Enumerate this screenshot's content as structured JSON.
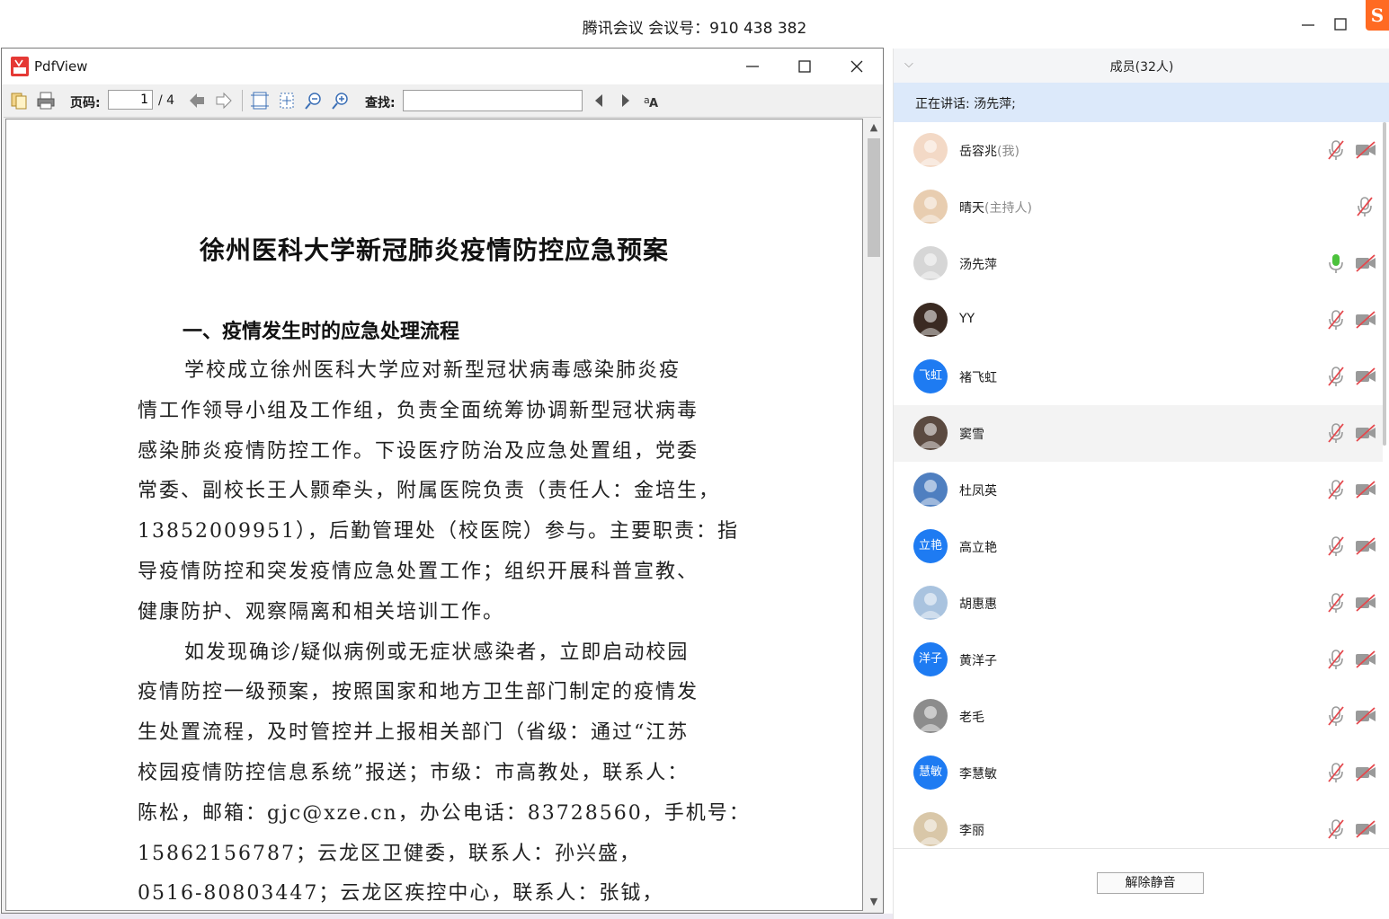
{
  "app": {
    "title": "腾讯会议 会议号：910 438 382",
    "brand_logo": "S"
  },
  "pdf": {
    "title": "PdfView",
    "toolbar": {
      "page_label": "页码:",
      "page_value": "1",
      "page_total": "/ 4",
      "find_label": "查找:",
      "find_value": ""
    },
    "document": {
      "title": "徐州医科大学新冠肺炎疫情防控应急预案",
      "heading": "一、疫情发生时的应急处理流程",
      "lines": [
        "学校成立徐州医科大学应对新型冠状病毒感染肺炎疫",
        "情工作领导小组及工作组，负责全面统筹协调新型冠状病毒",
        "感染肺炎疫情防控工作。下设医疗防治及应急处置组，党委",
        "常委、副校长王人颢牵头，附属医院负责（责任人：金培生，",
        "13852009951），后勤管理处（校医院）参与。主要职责：指",
        "导疫情防控和突发疫情应急处置工作；组织开展科普宣教、",
        "健康防护、观察隔离和相关培训工作。",
        "如发现确诊/疑似病例或无症状感染者，立即启动校园",
        "疫情防控一级预案，按照国家和地方卫生部门制定的疫情发",
        "生处置流程，及时管控并上报相关部门（省级：通过“江苏",
        "校园疫情防控信息系统”报送；市级：市高教处，联系人：",
        "陈松，邮箱：gjc@xze.cn，办公电话：83728560，手机号：",
        "15862156787；云龙区卫健委，联系人：孙兴盛，",
        "0516-80803447；云龙区疾控中心，联系人：张钺，"
      ]
    }
  },
  "members": {
    "header": "成员(32人)",
    "speaking": "正在讲话: 汤先萍;",
    "list": [
      {
        "name": "岳容兆",
        "role": "(我)",
        "avatar_text": "",
        "avatar_color": "#f3d9c6",
        "mic": "muted",
        "cam": "off"
      },
      {
        "name": "晴天",
        "role": "(主持人)",
        "avatar_text": "",
        "avatar_color": "#e8cdb0",
        "mic": "muted",
        "cam": "none"
      },
      {
        "name": "汤先萍",
        "role": "",
        "avatar_text": "",
        "avatar_color": "#d6d6d6",
        "mic": "active",
        "cam": "off"
      },
      {
        "name": "YY",
        "role": "",
        "avatar_text": "",
        "avatar_color": "#3a2a22",
        "mic": "muted",
        "cam": "off"
      },
      {
        "name": "褚飞虹",
        "role": "",
        "avatar_text": "飞虹",
        "avatar_color": "#1e7bf2",
        "mic": "muted",
        "cam": "off"
      },
      {
        "name": "窦雪",
        "role": "",
        "avatar_text": "",
        "avatar_color": "#5b4a40",
        "mic": "muted",
        "cam": "off"
      },
      {
        "name": "杜凤英",
        "role": "",
        "avatar_text": "",
        "avatar_color": "#4f7fc0",
        "mic": "muted",
        "cam": "off"
      },
      {
        "name": "高立艳",
        "role": "",
        "avatar_text": "立艳",
        "avatar_color": "#1e7bf2",
        "mic": "muted",
        "cam": "off"
      },
      {
        "name": "胡惠惠",
        "role": "",
        "avatar_text": "",
        "avatar_color": "#a9c3df",
        "mic": "muted",
        "cam": "off"
      },
      {
        "name": "黄洋子",
        "role": "",
        "avatar_text": "洋子",
        "avatar_color": "#1e7bf2",
        "mic": "muted",
        "cam": "off"
      },
      {
        "name": "老毛",
        "role": "",
        "avatar_text": "",
        "avatar_color": "#8c8c8c",
        "mic": "muted",
        "cam": "off"
      },
      {
        "name": "李慧敏",
        "role": "",
        "avatar_text": "慧敏",
        "avatar_color": "#1e7bf2",
        "mic": "muted",
        "cam": "off"
      },
      {
        "name": "李丽",
        "role": "",
        "avatar_text": "",
        "avatar_color": "#d9c7a8",
        "mic": "muted",
        "cam": "off"
      }
    ],
    "footer_button": "解除静音"
  },
  "colors": {
    "accent": "#1e7bf2",
    "speaking_bg": "#dce9fa",
    "muted_red": "#e5484d",
    "mic_active": "#4cc23c"
  }
}
